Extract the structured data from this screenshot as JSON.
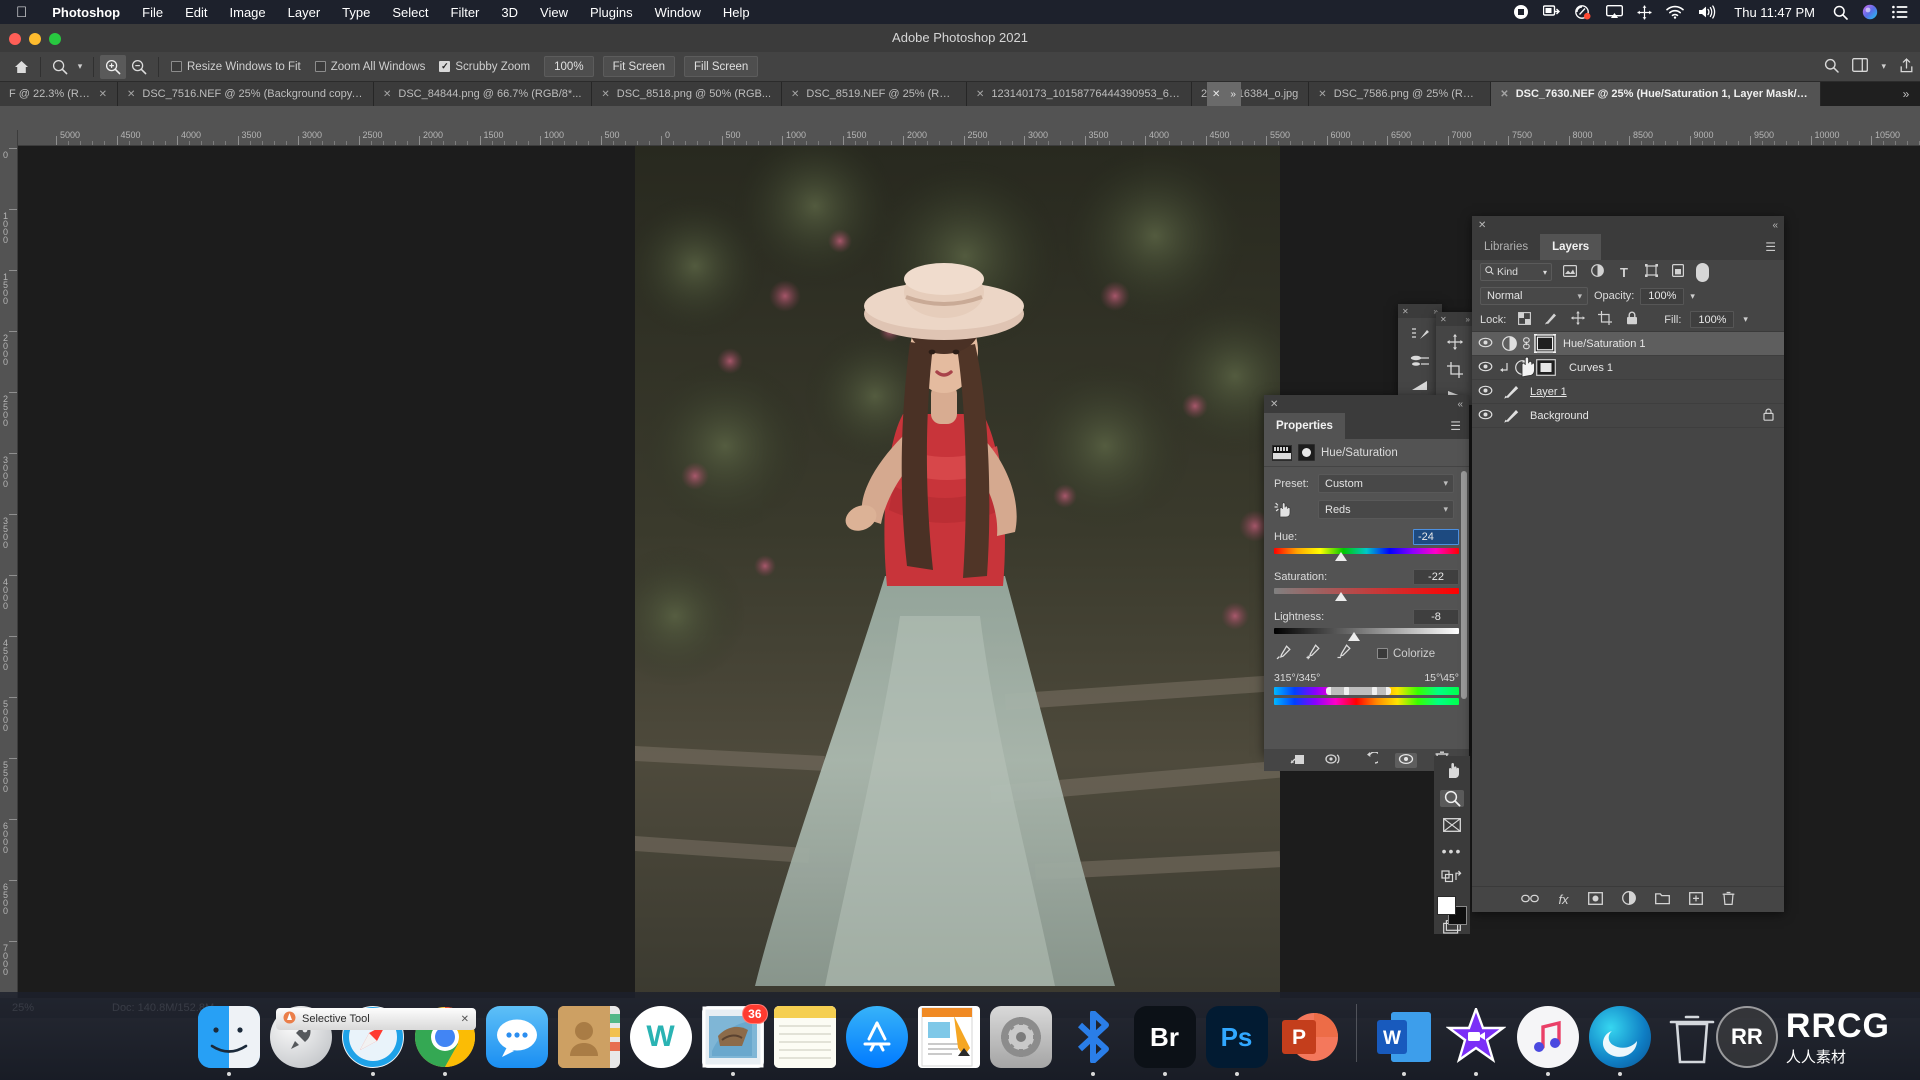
{
  "menubar": {
    "apple": "apple-logo",
    "items": [
      "Photoshop",
      "File",
      "Edit",
      "Image",
      "Layer",
      "Type",
      "Select",
      "Filter",
      "3D",
      "View",
      "Plugins",
      "Window",
      "Help"
    ],
    "clock": "Thu 11:47 PM",
    "status_icons": [
      "record-icon",
      "screen-share-icon",
      "sound-meter-icon",
      "airplay-icon",
      "expand-icon",
      "wifi-icon",
      "volume-icon",
      "search-icon",
      "siri-icon",
      "control-center-icon"
    ]
  },
  "window": {
    "title": "Adobe Photoshop 2021"
  },
  "options_bar": {
    "home_icon": "home-icon",
    "tool_icon": "zoom-tool-icon",
    "zoom_in_icon": "zoom-in-icon",
    "zoom_out_icon": "zoom-out-icon",
    "checks": [
      {
        "label": "Resize Windows to Fit",
        "checked": false
      },
      {
        "label": "Zoom All Windows",
        "checked": false
      },
      {
        "label": "Scrubby Zoom",
        "checked": true
      }
    ],
    "buttons": [
      "100%",
      "Fit Screen",
      "Fill Screen"
    ],
    "right_icons": [
      "search-icon",
      "workspace-icon",
      "chevron-down-icon",
      "share-icon"
    ]
  },
  "tabs": [
    {
      "label": "F @ 22.3% (RGB/...",
      "active": false
    },
    {
      "label": "DSC_7516.NEF @ 25% (Background copy, RGB/...",
      "active": false
    },
    {
      "label": "DSC_84844.png @ 66.7% (RGB/8*...",
      "active": false
    },
    {
      "label": "DSC_8518.png @ 50% (RGB...",
      "active": false
    },
    {
      "label": "DSC_8519.NEF @ 25% (RGB/...",
      "active": false
    },
    {
      "label": "123140173_10158776444390953_60...",
      "active": false
    },
    {
      "label": "20237916384_o.jpg",
      "active": false
    },
    {
      "label": "DSC_7586.png @ 25% (RGB...",
      "active": false
    },
    {
      "label": "DSC_7630.NEF @ 25% (Hue/Saturation 1, Layer Mask/8) *",
      "active": true
    }
  ],
  "tab_overflow_icon": "chevrons-right-icon",
  "rulers": {
    "left_labels": [
      "5000",
      "4500",
      "4000",
      "3500",
      "3000",
      "2500",
      "2000",
      "1500",
      "1000",
      "500",
      "0",
      "500",
      "1000",
      "1500",
      "2000",
      "2500",
      "3000",
      "3500",
      "4000",
      "4500"
    ],
    "right_labels": [
      "0",
      "5500",
      "6000",
      "6500",
      "7000",
      "7500",
      "8000",
      "8500",
      "9000",
      "9500",
      "10000",
      "10500"
    ],
    "vertical_labels": [
      "0",
      "1000",
      "1500",
      "2000",
      "2500",
      "3000",
      "3500",
      "4000",
      "4500",
      "5000",
      "5500",
      "6000",
      "6500",
      "7000"
    ]
  },
  "properties": {
    "panel_title": "Properties",
    "adjustment_name": "Hue/Saturation",
    "preset_label": "Preset:",
    "preset_value": "Custom",
    "channel_value": "Reds",
    "hand_icon": "on-image-adjust-icon",
    "sliders": [
      {
        "label": "Hue:",
        "value": "-24",
        "selected": true
      },
      {
        "label": "Saturation:",
        "value": "-22",
        "selected": false
      },
      {
        "label": "Lightness:",
        "value": "-8",
        "selected": false
      }
    ],
    "eyedroppers": [
      "eyedropper-icon",
      "eyedropper-add-icon",
      "eyedropper-subtract-icon"
    ],
    "colorize_label": "Colorize",
    "colorize_checked": false,
    "range_left": "315°/345°",
    "range_right": "15°\\45°",
    "footer_icons": [
      "clip-to-layer-icon",
      "toggle-view-icon",
      "reset-icon",
      "eye-icon",
      "delete-icon"
    ]
  },
  "layers": {
    "tabs": [
      {
        "label": "Libraries",
        "selected": false
      },
      {
        "label": "Layers",
        "selected": true
      }
    ],
    "filter_label": "Kind",
    "filter_icons": [
      "pixel-filter-icon",
      "adjustment-filter-icon",
      "type-filter-icon",
      "shape-filter-icon",
      "smart-object-filter-icon"
    ],
    "filter_toggle": "filter-toggle-icon",
    "blend_mode": "Normal",
    "opacity_label": "Opacity:",
    "opacity_value": "100%",
    "lock_label": "Lock:",
    "lock_icons": [
      "lock-transparency-icon",
      "lock-image-icon",
      "lock-position-icon",
      "lock-artboard-icon",
      "lock-all-icon"
    ],
    "fill_label": "Fill:",
    "fill_value": "100%",
    "rows": [
      {
        "name": "Hue/Saturation 1",
        "visible": true,
        "selected": true,
        "kind": "adjustment",
        "linked": true,
        "locked": false,
        "underline": false
      },
      {
        "name": "Curves 1",
        "visible": true,
        "selected": false,
        "kind": "adjustment",
        "clipped": true,
        "locked": false,
        "underline": false
      },
      {
        "name": "Layer 1",
        "visible": true,
        "selected": false,
        "kind": "pixel",
        "locked": false,
        "underline": true
      },
      {
        "name": "Background",
        "visible": true,
        "selected": false,
        "kind": "pixel",
        "locked": true,
        "underline": false
      }
    ],
    "footer_icons": [
      "link-layers-icon",
      "fx-icon",
      "add-mask-icon",
      "adjustment-layer-icon",
      "new-group-icon",
      "new-layer-icon",
      "delete-layer-icon"
    ]
  },
  "mini_panels": [
    {
      "icons": [
        "brush-settings-icon",
        "brush-preset-icon",
        "gradient-icon"
      ]
    },
    {
      "icons": [
        "move-tool-icon",
        "crop-tool-icon",
        "shape-icon"
      ]
    }
  ],
  "right_toolbar": {
    "icons": [
      "hand-tool-icon",
      "zoom-tool-icon",
      "screen-mode-icon",
      "more-tools-icon",
      "swap-colors-icon"
    ],
    "active": "zoom-tool-icon",
    "foreground_color": "#ffffff",
    "background_color": "#0f0f0f"
  },
  "status_bar": {
    "zoom": "25%",
    "doc": "Doc: 140.8M/152.8M",
    "arrow": "›"
  },
  "floating_tooltip": {
    "label": "Selective Tool"
  },
  "dock": [
    {
      "name": "Finder",
      "icon": "finder-icon",
      "running": true
    },
    {
      "name": "Launchpad",
      "icon": "launchpad-icon",
      "running": false
    },
    {
      "name": "Safari",
      "icon": "safari-icon",
      "running": true
    },
    {
      "name": "Google Chrome",
      "icon": "chrome-icon",
      "running": true
    },
    {
      "name": "Messages",
      "icon": "messages-icon",
      "running": false
    },
    {
      "name": "Contacts",
      "icon": "contacts-icon",
      "running": false
    },
    {
      "name": "WPS",
      "icon": "wps-icon",
      "running": false
    },
    {
      "name": "Mail",
      "icon": "mail-icon",
      "running": true,
      "badge": "36"
    },
    {
      "name": "Notes",
      "icon": "notes-icon",
      "running": false
    },
    {
      "name": "App Store",
      "icon": "appstore-icon",
      "running": false
    },
    {
      "name": "Pages",
      "icon": "pages-icon",
      "running": false
    },
    {
      "name": "System Preferences",
      "icon": "system-preferences-icon",
      "running": false
    },
    {
      "name": "Bluetooth",
      "icon": "bluetooth-icon",
      "running": true
    },
    {
      "name": "Adobe Bridge",
      "icon": "bridge-icon",
      "running": true
    },
    {
      "name": "Adobe Photoshop",
      "icon": "photoshop-icon",
      "running": true
    },
    {
      "name": "PowerPoint",
      "icon": "powerpoint-icon",
      "running": false
    },
    {
      "name": "Microsoft Word",
      "icon": "word-icon",
      "running": true
    },
    {
      "name": "iMovie",
      "icon": "imovie-icon",
      "running": true
    },
    {
      "name": "iTunes",
      "icon": "itunes-icon",
      "running": true
    },
    {
      "name": "Edge",
      "icon": "edge-icon",
      "running": true
    },
    {
      "name": "Trash",
      "icon": "trash-icon",
      "running": false
    }
  ],
  "watermark": {
    "logo": "RR",
    "title": "RRCG",
    "subtitle": "人人素材"
  },
  "colors": {
    "menubar_bg": "#1d212c",
    "panel_bg": "#454545",
    "app_bg": "#535353",
    "canvas_bg": "#1c1c1c",
    "selection_blue": "#1d4a80",
    "badge_red": "#ff3b30"
  }
}
